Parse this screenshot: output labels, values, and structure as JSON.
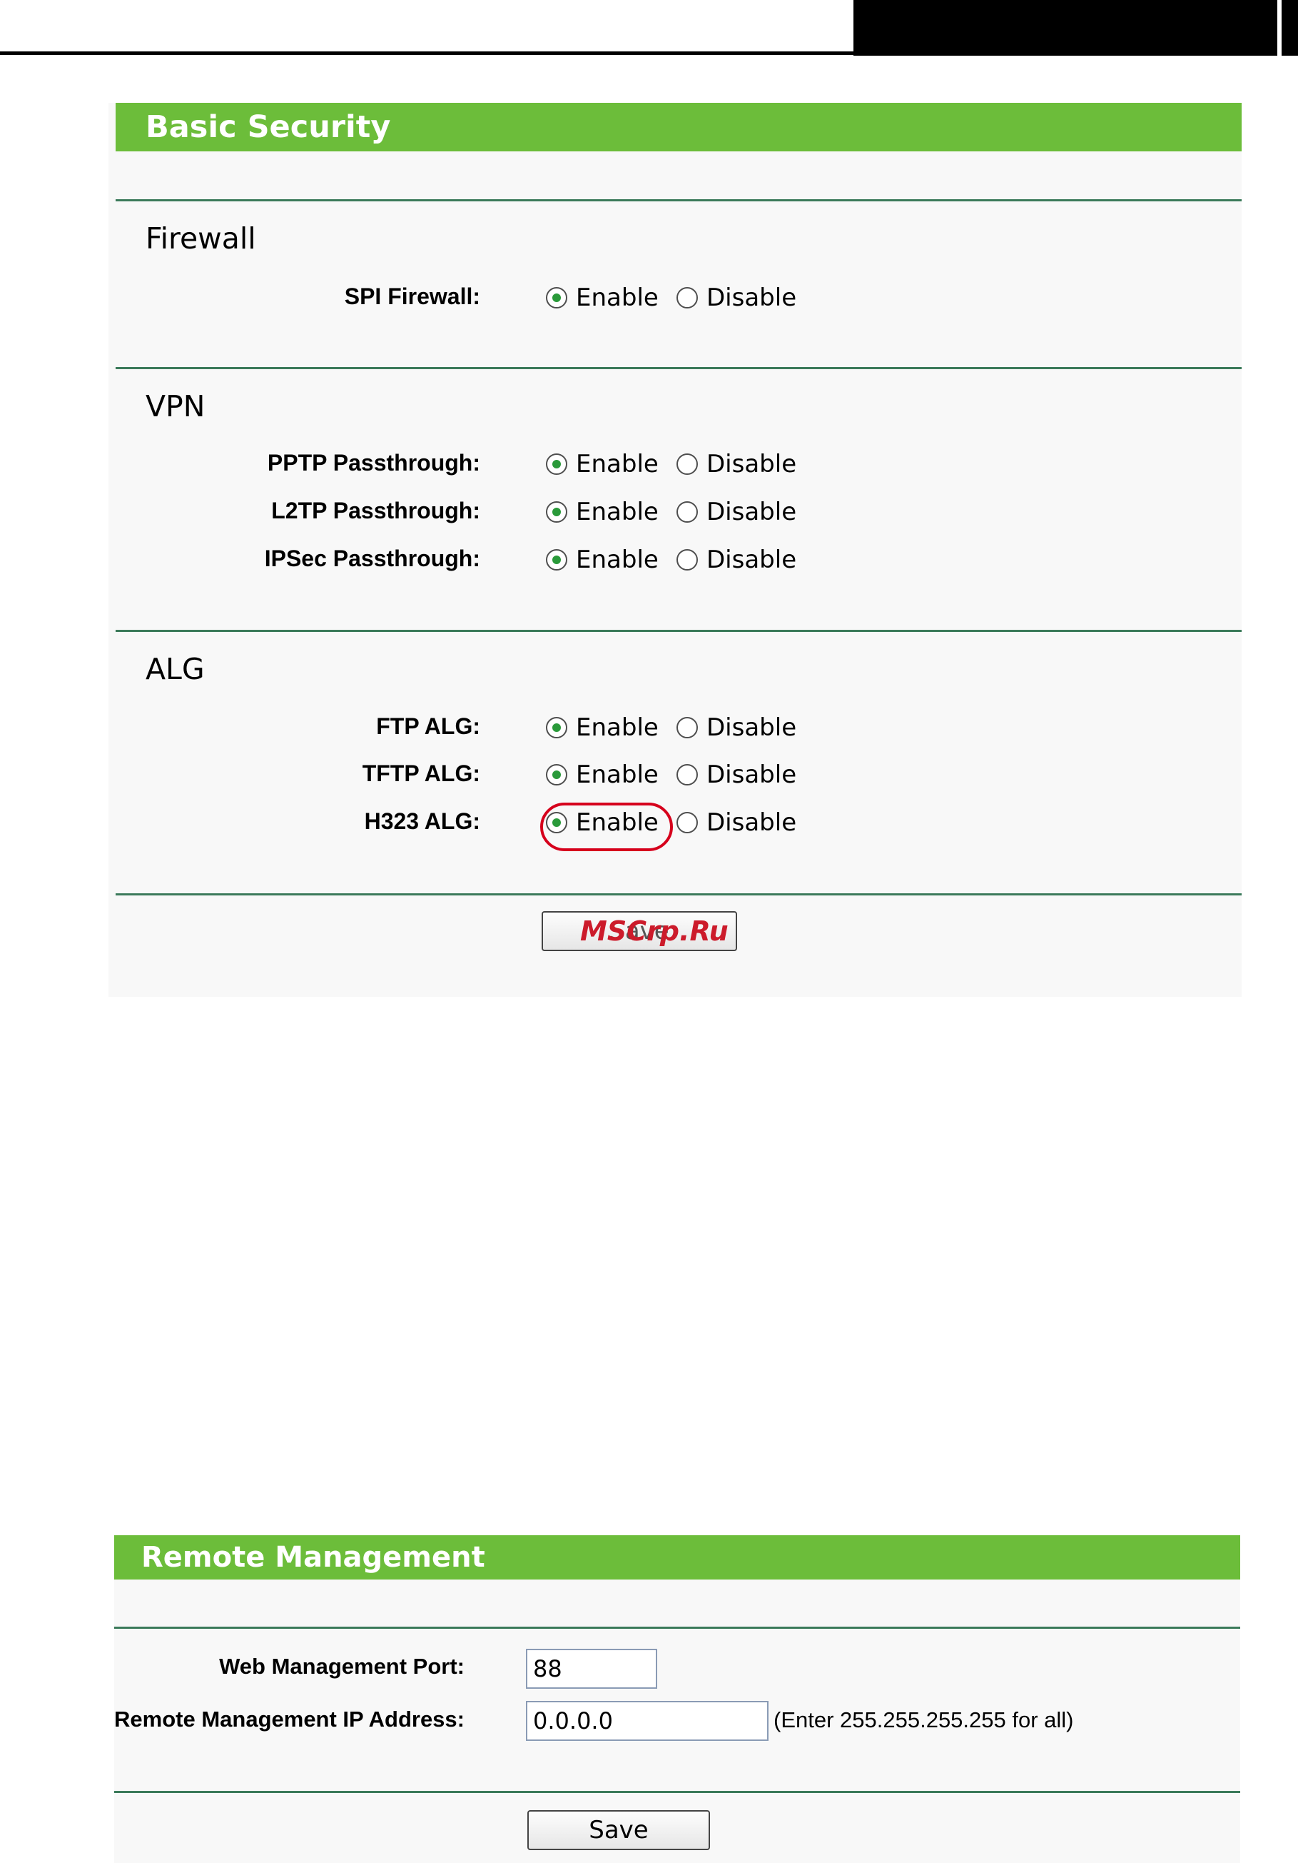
{
  "basic_security": {
    "title": "Basic Security",
    "firewall": {
      "heading": "Firewall",
      "rows": [
        {
          "label": "SPI Firewall:",
          "enable": "Enable",
          "disable": "Disable",
          "selected": "Enable"
        }
      ]
    },
    "vpn": {
      "heading": "VPN",
      "rows": [
        {
          "label": "PPTP Passthrough:",
          "enable": "Enable",
          "disable": "Disable",
          "selected": "Enable"
        },
        {
          "label": "L2TP Passthrough:",
          "enable": "Enable",
          "disable": "Disable",
          "selected": "Enable"
        },
        {
          "label": "IPSec Passthrough:",
          "enable": "Enable",
          "disable": "Disable",
          "selected": "Enable"
        }
      ]
    },
    "alg": {
      "heading": "ALG",
      "rows": [
        {
          "label": "FTP ALG:",
          "enable": "Enable",
          "disable": "Disable",
          "selected": "Enable"
        },
        {
          "label": "TFTP ALG:",
          "enable": "Enable",
          "disable": "Disable",
          "selected": "Enable"
        },
        {
          "label": "H323 ALG:",
          "enable": "Enable",
          "disable": "Disable",
          "selected": "Enable"
        }
      ]
    },
    "save_label": "Save",
    "watermark": "MSCrp.Ru"
  },
  "remote_management": {
    "title": "Remote Management",
    "web_port": {
      "label": "Web Management Port:",
      "value": "88"
    },
    "remote_ip": {
      "label": "Remote Management IP Address:",
      "value": "0.0.0.0",
      "hint": "(Enter 255.255.255.255 for all)"
    },
    "save_label": "Save"
  },
  "colors": {
    "header_green": "#6cbd3a",
    "separator": "#3b7a5a",
    "highlight_red": "#d6001c"
  }
}
